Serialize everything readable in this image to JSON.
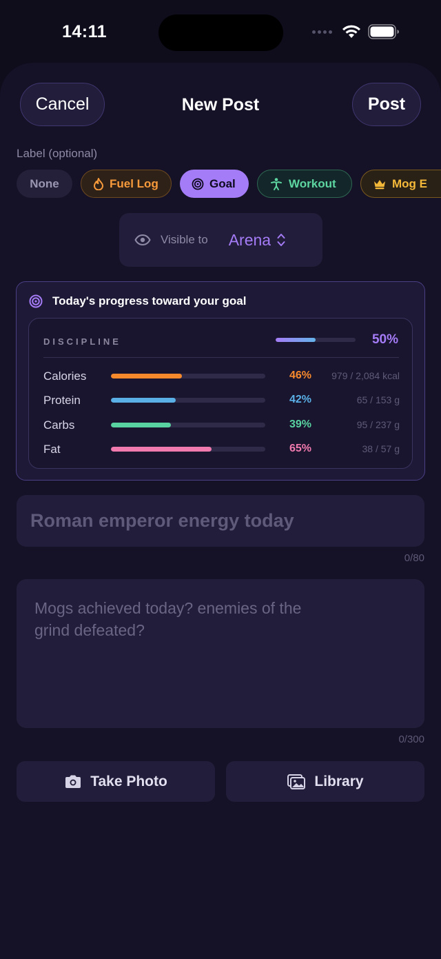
{
  "status_bar": {
    "time": "14:11"
  },
  "nav": {
    "cancel_label": "Cancel",
    "title": "New Post",
    "post_label": "Post"
  },
  "label_section": {
    "title": "Label (optional)",
    "chips": [
      {
        "label": "None",
        "icon": "none",
        "selected": false
      },
      {
        "label": "Fuel Log",
        "icon": "flame-icon",
        "selected": false,
        "color": "#f79a3b"
      },
      {
        "label": "Goal",
        "icon": "target-icon",
        "selected": true,
        "color": "#a57cf7"
      },
      {
        "label": "Workout",
        "icon": "workout-figure-icon",
        "selected": false,
        "color": "#5ed6a2"
      },
      {
        "label": "Mog E",
        "icon": "crown-icon",
        "selected": false,
        "color": "#f5b93a"
      }
    ]
  },
  "visibility": {
    "label": "Visible to",
    "value": "Arena"
  },
  "progress": {
    "header": "Today's progress toward your goal",
    "discipline": {
      "label": "DISCIPLINE",
      "percent_text": "50%",
      "fraction": 0.5
    },
    "macros": [
      {
        "name": "Calories",
        "percent_text": "46%",
        "fraction": 0.46,
        "amount": "979 / 2,084 kcal",
        "color": "#f7892d"
      },
      {
        "name": "Protein",
        "percent_text": "42%",
        "fraction": 0.42,
        "amount": "65 / 153 g",
        "color": "#5ab0e6"
      },
      {
        "name": "Carbs",
        "percent_text": "39%",
        "fraction": 0.39,
        "amount": "95 / 237 g",
        "color": "#58d2a0"
      },
      {
        "name": "Fat",
        "percent_text": "65%",
        "fraction": 0.65,
        "amount": "38 / 57 g",
        "color": "#f07aae"
      }
    ]
  },
  "title_input": {
    "placeholder": "Roman emperor energy today",
    "counter": "0/80"
  },
  "body_input": {
    "placeholder": "Mogs achieved today? enemies of the grind defeated?",
    "counter": "0/300"
  },
  "actions": {
    "take_photo_label": "Take Photo",
    "library_label": "Library"
  }
}
